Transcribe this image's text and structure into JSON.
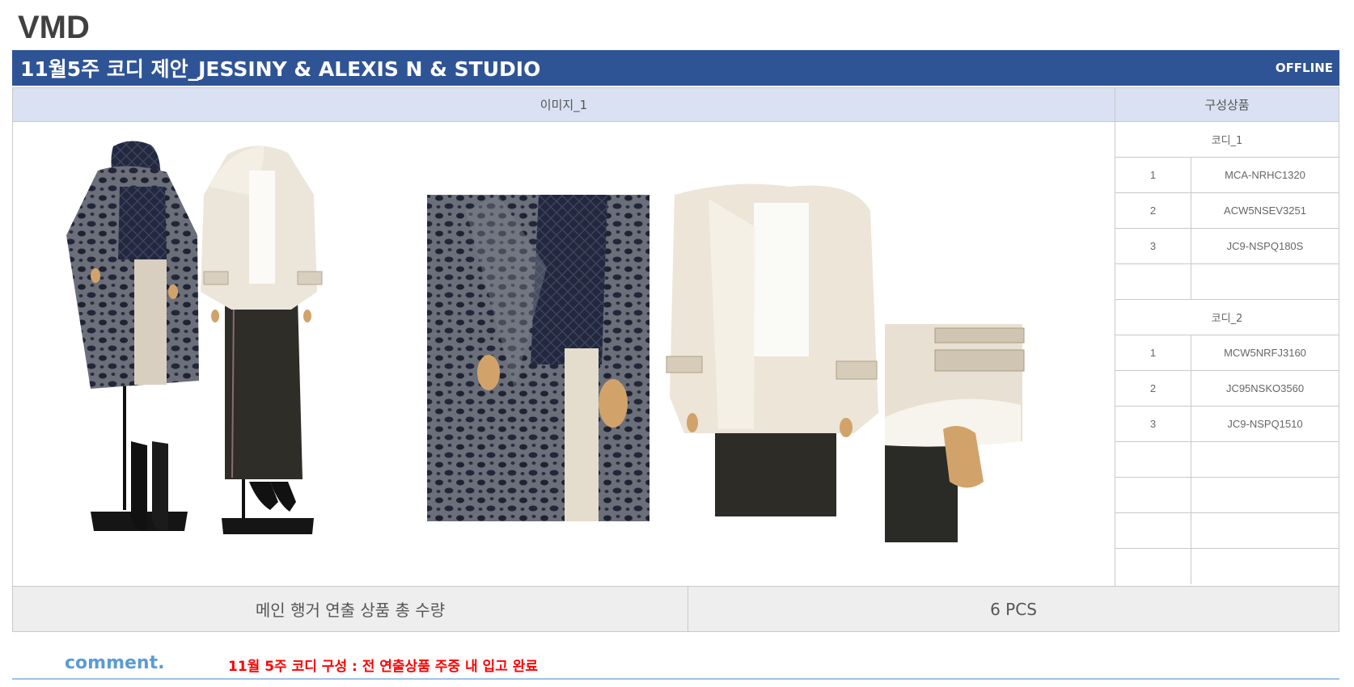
{
  "header": {
    "brand": "VMD"
  },
  "title_bar": {
    "title": "11월5주 코디 제안_JESSINY & ALEXIS N & STUDIO",
    "channel": "OFFLINE"
  },
  "table": {
    "image_header": "이미지_1",
    "products_header": "구성상품",
    "coordinates": [
      {
        "label": "코디_1",
        "items": [
          {
            "no": "1",
            "code": "MCA-NRHC1320"
          },
          {
            "no": "2",
            "code": "ACW5NSEV3251"
          },
          {
            "no": "3",
            "code": "JC9-NSPQ180S"
          },
          {
            "no": "",
            "code": ""
          }
        ]
      },
      {
        "label": "코디_2",
        "items": [
          {
            "no": "1",
            "code": "MCW5NRFJ3160"
          },
          {
            "no": "2",
            "code": "JC95NSKO3560"
          },
          {
            "no": "3",
            "code": "JC9-NSPQ1510"
          },
          {
            "no": "",
            "code": ""
          },
          {
            "no": "",
            "code": ""
          },
          {
            "no": "",
            "code": ""
          },
          {
            "no": "",
            "code": ""
          }
        ]
      }
    ]
  },
  "summary": {
    "label": "메인 행거 연출 상품 총 수량",
    "value": "6 PCS"
  },
  "comment": {
    "label": "comment.",
    "text": "11월 5주 코디 구성 : 전 연출상품 주중 내 입고 완료"
  },
  "colors": {
    "title_bar": "#2f5496",
    "header_fill": "#d9e1f2",
    "comment": "#5b9bd5",
    "note": "#ff0000"
  }
}
